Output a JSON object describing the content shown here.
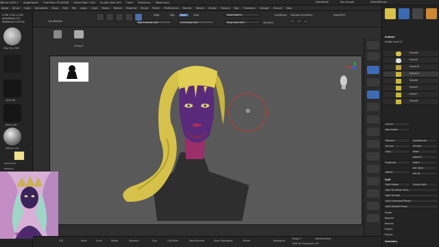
{
  "titlebar": {
    "items": [
      "ZBrush 2020.1",
      "AngelGamer",
      "Free Mem 20.349GB",
      "Active Mem 1190",
      "Scratch Disk 403",
      "Timer",
      "PolyCount",
      "MeshCount"
    ],
    "quicksave": "QuickSave",
    "seethrough": "See-through",
    "script": "DefaultZScript"
  },
  "menubar": [
    "Alpha",
    "Brush",
    "Color",
    "Document",
    "Draw",
    "Edit",
    "File",
    "Layer",
    "Light",
    "Macro",
    "Marker",
    "Material",
    "Movie",
    "Picker",
    "Preferences",
    "Render",
    "Stencil",
    "Stroke",
    "Texture",
    "Tool",
    "Transform",
    "Zplugin",
    "Zscript",
    "Help"
  ],
  "toolshelf": {
    "lightbox": "Live Boolean",
    "mrgb": "Mrgb",
    "rgb": "Rgb",
    "m": "M",
    "zadd": "Zadd",
    "zsub": "Zsub",
    "rgb_intensity": "Rgb Intensity 100",
    "z_intensity": "Z Intensity 100",
    "focal_shift": "Focal Shift 0",
    "draw_size": "Draw Size 358",
    "dynamic": "Dynamic",
    "lazymouse": "LazyMouse",
    "activate_symmetry": "Activate Symmetry",
    "spotlight": "ExpertXYZ",
    "brush1_label": "",
    "brush2_label": "Clump 2"
  },
  "left": {
    "coords": "0.796 1.334 -0.128",
    "active_points": "ActivePoints 274",
    "total_points": "TotalPoints 2.523 Mil",
    "alpha_label": "Alpha Off",
    "texture_label": "Texture Off",
    "material_label": "MatCap Gray",
    "switch_color": "SwitchColor",
    "fill_object": "FillObject",
    "double": "Double",
    "watermark": "@likyomen47"
  },
  "bottombar": {
    "items": [
      "XYZ",
      "Move",
      "Scale",
      "Rotate",
      "Standard",
      "Clay",
      "ClayTubes",
      "DamStandard",
      "Move Topological",
      "hPolish"
    ],
    "range": "Range 5",
    "backface": "BackfaceMask",
    "mask_poly": "Mask By Polygroups 100",
    "topological": "Topological"
  },
  "rightpanel": {
    "subtool_title": "Subtool",
    "visible_count": "Visible Count 8",
    "subtools": [
      "Eraser8",
      "Eraser9",
      "Eraser10",
      "Eraser11",
      "Eraser6",
      "Eraser5",
      "Eraser7",
      "Eraser8"
    ],
    "list_all": "List All",
    "new_folder": "New Folder",
    "rename": "Rename",
    "auto_reorder": "AutoReorder",
    "all_low": "All Low",
    "all_high": "All High",
    "copy": "Copy",
    "paste": "Paste",
    "append": "Append",
    "duplicate": "Duplicate",
    "insert": "Insert",
    "del_other": "Del Other",
    "delete": "Delete",
    "del_all": "Del All",
    "split_title": "Split",
    "split_hidden": "Split Hidden",
    "groups_split": "Groups Split",
    "split_similar": "Split To Similar Parts",
    "split_parts": "Split To Parts",
    "split_unmasked": "Split Unmasked Points",
    "split_masked": "Split Masked Points",
    "merge": "Merge",
    "boolean": "Boolean",
    "remesh": "Remesh",
    "project": "Project",
    "extract": "Extract",
    "geometry": "Geometry"
  },
  "colors": {
    "accent_blue": "#4a6fa8",
    "hair_yellow": "#d8c24a",
    "skin_purple": "#6a2a78",
    "brush_ring": "#c0392b"
  }
}
